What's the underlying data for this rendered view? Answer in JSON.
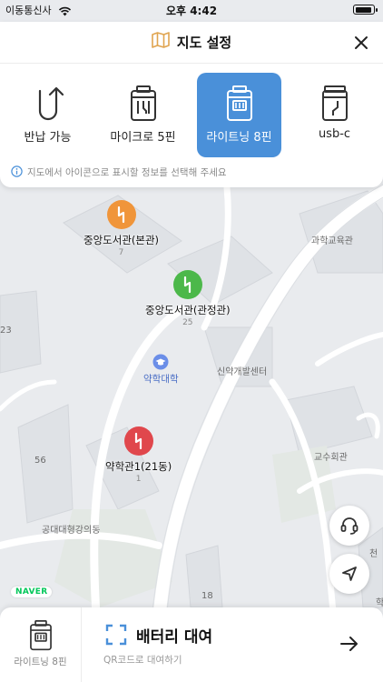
{
  "status_bar": {
    "carrier": "이동통신사",
    "time": "오후 4:42",
    "battery_level": 0.9
  },
  "header": {
    "title": "지도 설정",
    "icon": "map-icon",
    "close_icon": "close-icon"
  },
  "connector_types": [
    {
      "label": "반납 가능",
      "icon": "return-arrow-icon",
      "selected": false
    },
    {
      "label": "마이크로 5핀",
      "icon": "micro-5pin-cable-icon",
      "selected": false
    },
    {
      "label": "라이트닝 8핀",
      "icon": "lightning-8pin-cable-icon",
      "selected": true
    },
    {
      "label": "usb-c",
      "icon": "usb-c-cable-icon",
      "selected": false
    }
  ],
  "info_text": "지도에서 아이콘으로 표시할 정보를 선택해 주세요",
  "map": {
    "stations": [
      {
        "name": "중앙도서관(본관)",
        "count": "7",
        "color": "#f0953a"
      },
      {
        "name": "중앙도서관(관정관)",
        "count": "25",
        "color": "#4cb84a"
      },
      {
        "name": "약학관1(21동)",
        "count": "1",
        "color": "#e0474c"
      }
    ],
    "campus_poi": {
      "name": "약학대학",
      "icon": "school-cap-icon"
    },
    "places": [
      "과학교육관",
      "신약개발센터",
      "교수회관",
      "공대대형강의동",
      "천",
      "학"
    ],
    "building_numbers": [
      "23",
      "56",
      "18"
    ],
    "logo": "NAVER"
  },
  "map_buttons": {
    "support_icon": "headset-icon",
    "location_icon": "location-arrow-icon"
  },
  "bottom_bar": {
    "current_type_label": "라이트닝 8핀",
    "rent_title": "배터리 대여",
    "rent_subtitle": "QR코드로 대여하기"
  },
  "colors": {
    "accent": "#4a90d9",
    "map_background": "#e9ebee",
    "map_road": "#ffffff",
    "map_building": "#dfe2e6",
    "naver_green": "#03c75a"
  }
}
